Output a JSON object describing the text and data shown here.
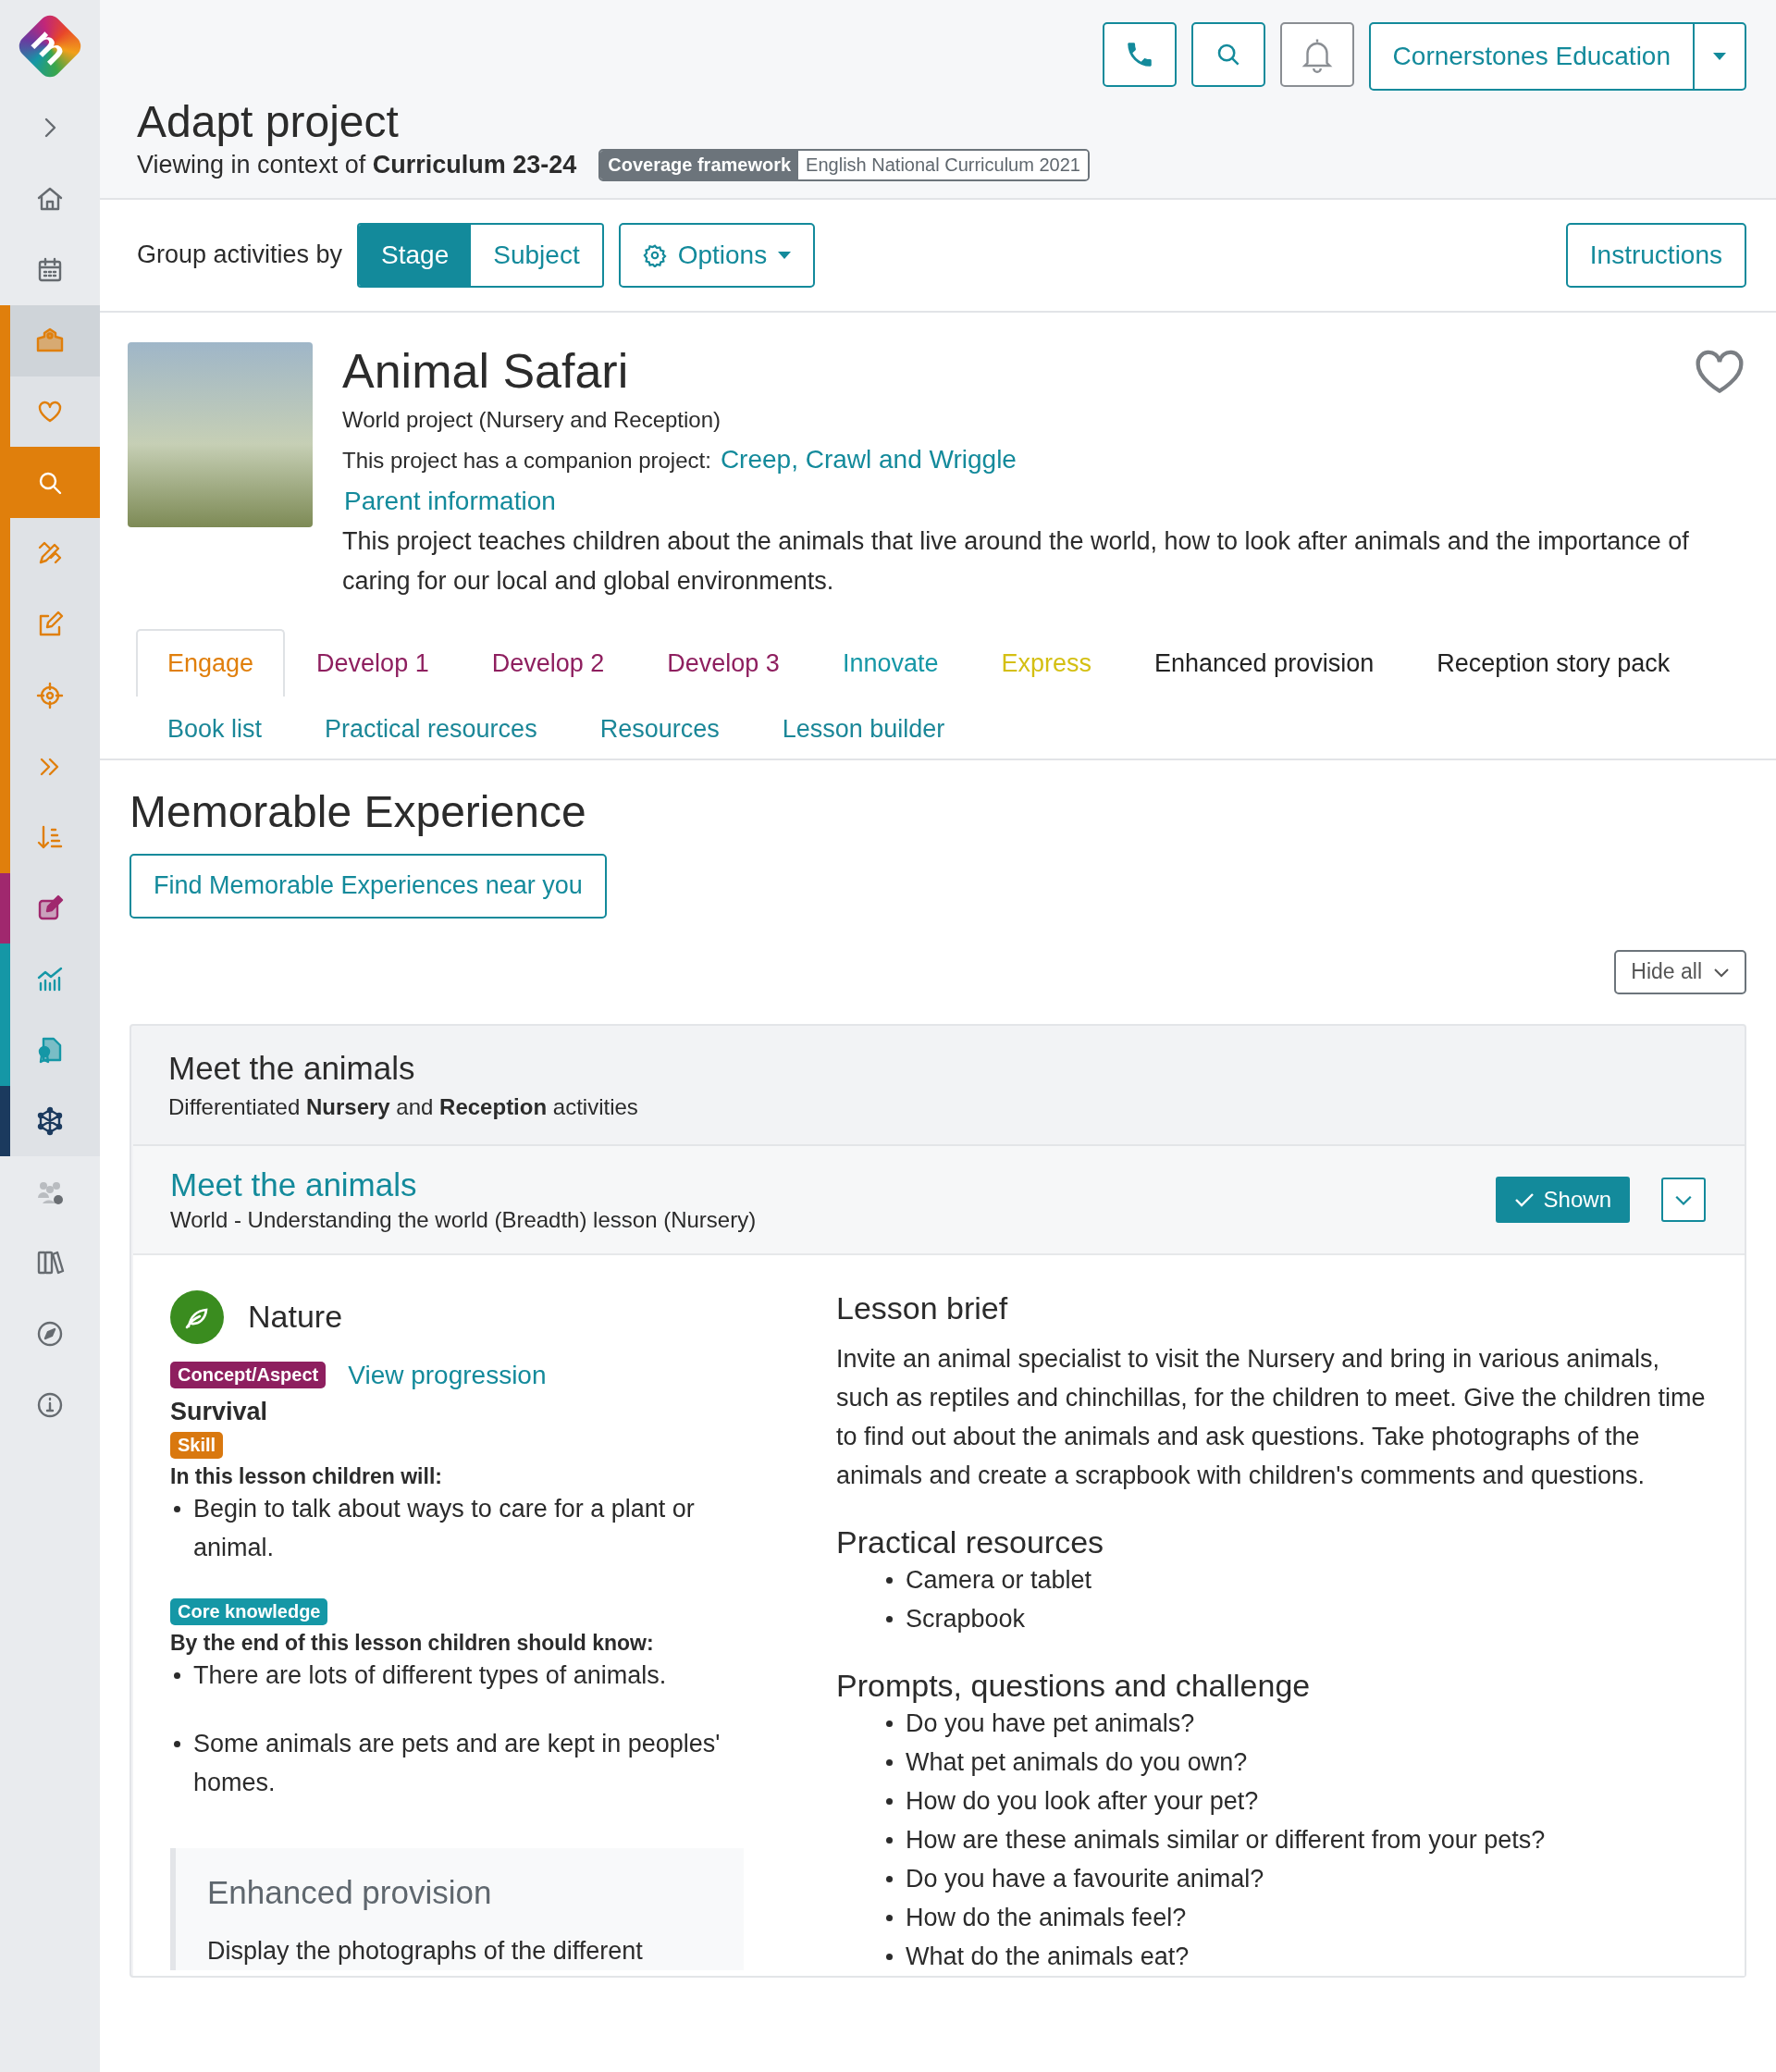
{
  "sidebar": {
    "logo": {
      "letter": "m"
    },
    "items": [
      {
        "kind": "expand",
        "selected": false
      },
      {
        "kind": "home",
        "selected": false
      },
      {
        "kind": "calendar",
        "selected": false
      },
      {
        "kind": "school",
        "selected": false,
        "current": true,
        "color": "#e07f0c"
      },
      {
        "kind": "heart",
        "selected": false,
        "current": false,
        "color": "#e07f0c"
      },
      {
        "kind": "search",
        "selected": true,
        "current": false,
        "color": "#e07f0c"
      },
      {
        "kind": "pencil-ruler",
        "selected": false,
        "current": false,
        "color": "#e07f0c"
      },
      {
        "kind": "edit",
        "selected": false,
        "current": false,
        "color": "#e07f0c"
      },
      {
        "kind": "target",
        "selected": false,
        "current": false,
        "color": "#e07f0c"
      },
      {
        "kind": "double-chevron",
        "selected": false,
        "current": false,
        "color": "#e07f0c"
      },
      {
        "kind": "sort",
        "selected": false,
        "current": false,
        "color": "#e07f0c"
      },
      {
        "kind": "edit-solid",
        "selected": false,
        "current": false,
        "color": "#a0286e"
      },
      {
        "kind": "chart",
        "selected": false,
        "current": false,
        "color": "#1597a6"
      },
      {
        "kind": "certificate",
        "selected": false,
        "current": false,
        "color": "#1597a6"
      },
      {
        "kind": "network",
        "selected": false,
        "current": false,
        "color": "#1b3a5e"
      },
      {
        "kind": "people-gear",
        "selected": false
      },
      {
        "kind": "books",
        "selected": false
      },
      {
        "kind": "compass",
        "selected": false
      },
      {
        "kind": "info",
        "selected": false
      }
    ]
  },
  "header": {
    "account": "Cornerstones Education",
    "title": "Adapt project",
    "context": "Viewing in context of **Curriculum 23-24**",
    "framework_label": "Coverage framework",
    "framework_value": "English National Curriculum 2021"
  },
  "toolbar": {
    "label": "Group activities by",
    "segments": [
      {
        "label": "Stage",
        "selected": true
      },
      {
        "label": "Subject",
        "selected": false
      }
    ],
    "options": "Options",
    "instructions": "Instructions"
  },
  "project": {
    "title": "Animal Safari",
    "subtitle": "World project (Nursery and Reception)",
    "companion_text": "This project has a companion project:",
    "companion_link": "Creep, Crawl and Wriggle",
    "parent_link": "Parent information",
    "description": "This project teaches children about the animals that live around the world, how to look after animals and the importance of caring for our local and global environments."
  },
  "tab_rows": [
    [
      {
        "label": "Engage",
        "selected": true,
        "color": "#e07f0c"
      },
      {
        "label": "Develop 1",
        "selected": false,
        "color": "#8e1f5f"
      },
      {
        "label": "Develop 2",
        "selected": false,
        "color": "#8e1f5f"
      },
      {
        "label": "Develop 3",
        "selected": false,
        "color": "#8e1f5f"
      },
      {
        "label": "Innovate",
        "selected": false,
        "color": "#1597a6"
      },
      {
        "label": "Express",
        "selected": false,
        "color": "#d4bf12"
      },
      {
        "label": "Enhanced provision",
        "selected": false,
        "color": "#222222"
      },
      {
        "label": "Reception story pack",
        "selected": false,
        "color": "#222222"
      }
    ],
    [
      {
        "label": "Book list",
        "selected": false,
        "color": "#1b8798"
      },
      {
        "label": "Practical resources",
        "selected": false,
        "color": "#1b8798"
      },
      {
        "label": "Resources",
        "selected": false,
        "color": "#1b8798"
      },
      {
        "label": "Lesson builder",
        "selected": false,
        "color": "#1b8798"
      }
    ]
  ],
  "section": {
    "title": "Memorable Experience",
    "find_button": "Find Memorable Experiences near you",
    "hide_all": "Hide all"
  },
  "group": {
    "title": "Meet the animals",
    "subtitle": "Differentiated **Nursery** and **Reception** activities"
  },
  "lesson": {
    "title": "Meet the animals",
    "subtitle": "World - Understanding the world (Breadth) lesson (Nursery)",
    "shown": true,
    "shown_label": "Shown",
    "aspect": "Nature",
    "concept_badge": {
      "label": "Concept/Aspect",
      "color": "#8e1f5f"
    },
    "progression_link": "View progression",
    "concept": "Survival",
    "skill_badge": {
      "label": "Skill",
      "color": "#d9780f"
    },
    "skill_intro": "In this lesson children will:",
    "skills": [
      "Begin to talk about ways to care for a plant or animal."
    ],
    "knowledge_badge": {
      "label": "Core knowledge",
      "color": "#1597a6"
    },
    "knowledge_intro": "By the end of this lesson children should know:",
    "knowledge": [
      "There are lots of different types of animals.",
      "Some animals are pets and are kept in peoples' homes."
    ],
    "enhanced_title": "Enhanced provision",
    "enhanced_text": "Display the photographs of the different",
    "brief_title": "Lesson brief",
    "brief": "Invite an animal specialist to visit the Nursery and bring in various animals, such as reptiles and chinchillas, for the children to meet. Give the children time to find out about the animals and ask questions. Take photographs of the animals and create a scrapbook with children's comments and questions.",
    "resources_title": "Practical resources",
    "resources": [
      "Camera or tablet",
      "Scrapbook"
    ],
    "prompts_title": "Prompts, questions and challenge",
    "prompts": [
      "Do you have pet animals?",
      "What pet animals do you own?",
      "How do you look after your pet?",
      "How are these animals similar or different from your pets?",
      "Do you have a favourite animal?",
      "How do the animals feel?",
      "What do the animals eat?"
    ]
  }
}
